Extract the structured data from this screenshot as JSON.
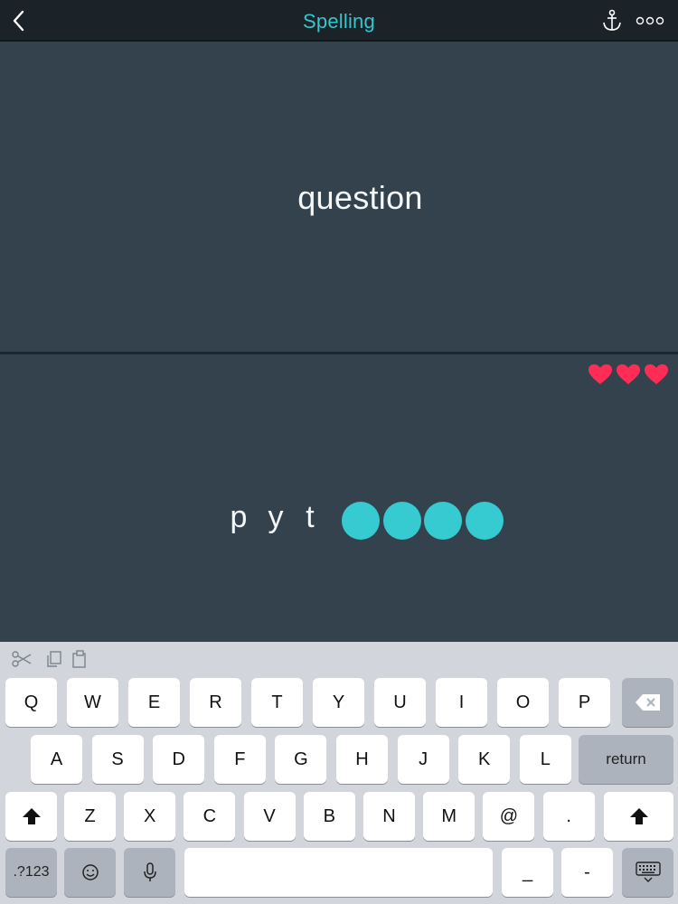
{
  "app": {
    "title": "Spelling",
    "colors": {
      "accent": "#35c5cc",
      "heart": "#ff2d55",
      "slot": "#35cbd1",
      "panel": "#33424d",
      "navbar": "#1b2228"
    },
    "nav_icons": [
      "chevron-left-icon",
      "anchor-icon",
      "more-icon"
    ]
  },
  "prompt": {
    "word": "question"
  },
  "lives": {
    "count": 3,
    "icon": "heart-icon"
  },
  "answer": {
    "typed_letters": [
      "p",
      "y",
      "t"
    ],
    "remaining_slots": 4
  },
  "keyboard": {
    "tool_icons": [
      "scissors-icon",
      "copy-icon",
      "paste-icon"
    ],
    "row1": [
      "Q",
      "W",
      "E",
      "R",
      "T",
      "Y",
      "U",
      "I",
      "O",
      "P"
    ],
    "row2": [
      "A",
      "S",
      "D",
      "F",
      "G",
      "H",
      "J",
      "K",
      "L"
    ],
    "row3": [
      "Z",
      "X",
      "C",
      "V",
      "B",
      "N",
      "M",
      "@",
      "."
    ],
    "return_label": "return",
    "numbers_label": ".?123",
    "underscore_label": "_",
    "dash_label": "-"
  }
}
